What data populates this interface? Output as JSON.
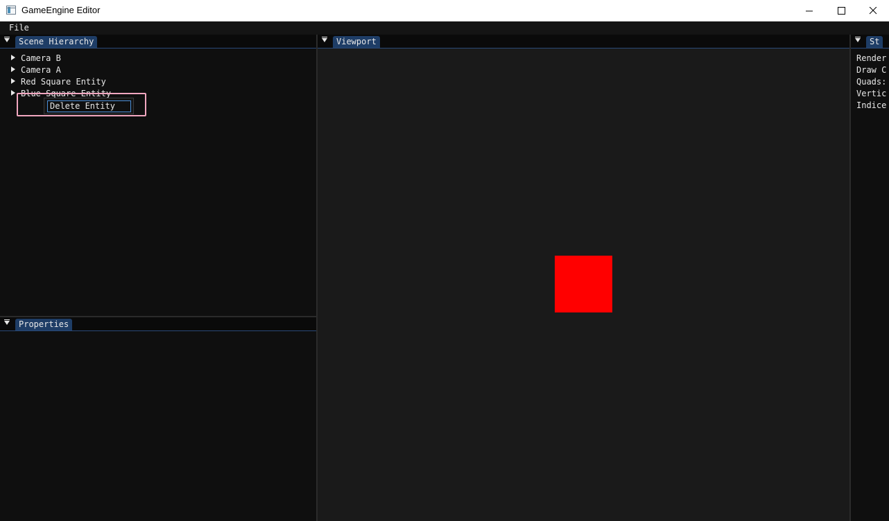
{
  "window": {
    "title": "GameEngine Editor",
    "icon": "app-window-icon",
    "controls": [
      "minimize-icon",
      "maximize-icon",
      "close-icon"
    ]
  },
  "menu": {
    "file": "File"
  },
  "scene_hierarchy": {
    "title": "Scene Hierarchy",
    "items": [
      {
        "label": "Camera B"
      },
      {
        "label": "Camera A"
      },
      {
        "label": "Red Square Entity"
      },
      {
        "label": "Blue Square Entity"
      }
    ],
    "context_menu": {
      "delete": "Delete Entity"
    }
  },
  "properties": {
    "title": "Properties"
  },
  "viewport": {
    "title": "Viewport",
    "background_color": "#1a1a1a",
    "entity_color": "#ff0000"
  },
  "stats": {
    "title": "St",
    "lines": [
      "Render",
      "Draw C",
      "Quads:",
      "Vertic",
      "Indice"
    ]
  },
  "colors": {
    "tab_active": "#1e3d66",
    "highlight": "#f2a7c0",
    "selection_border": "#4a8fd9"
  }
}
